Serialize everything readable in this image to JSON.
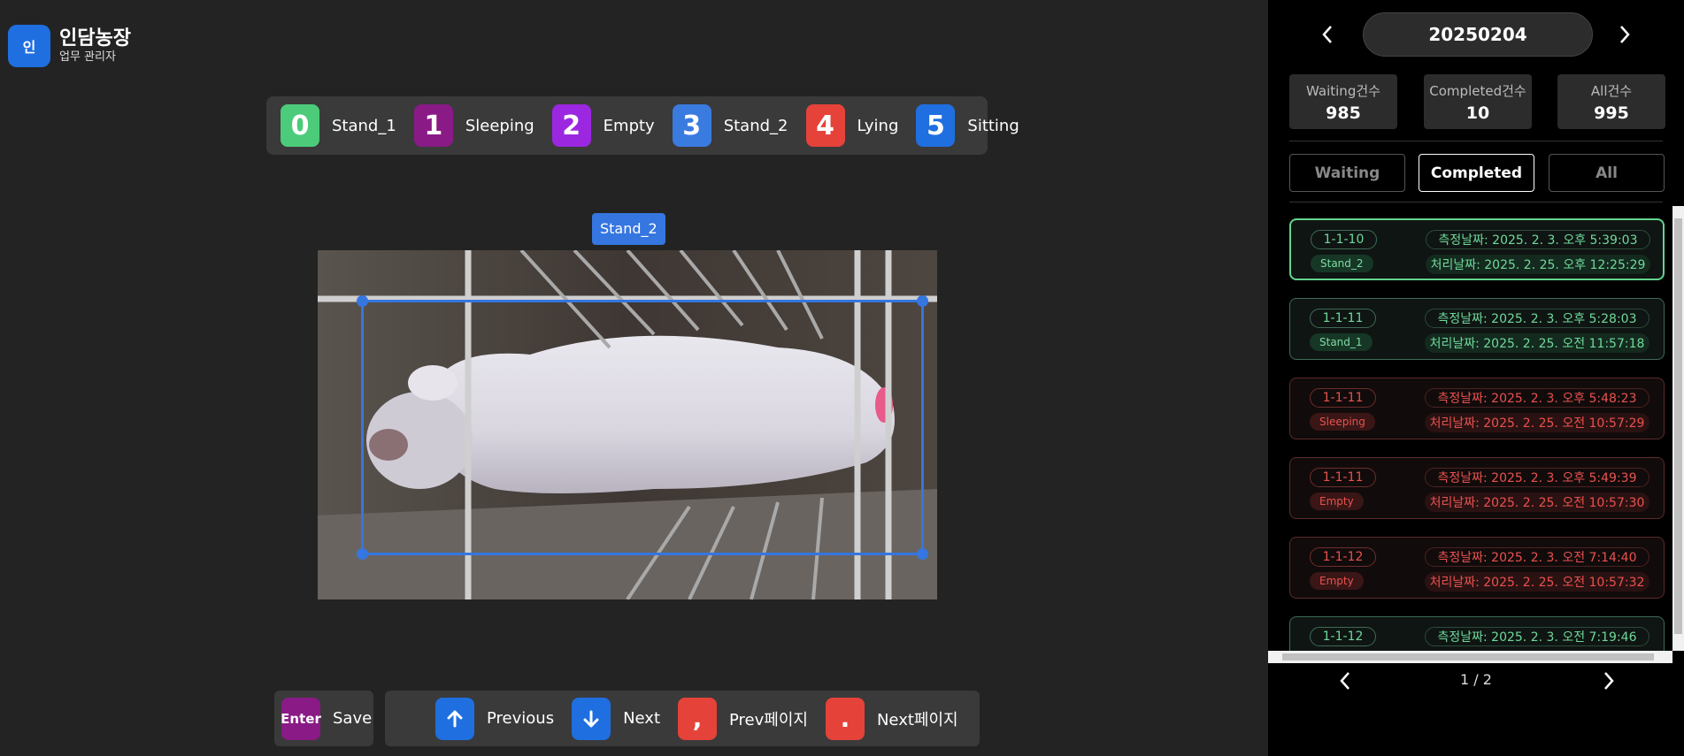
{
  "app": {
    "logo_char": "인",
    "title": "인담농장",
    "subtitle": "업무 관리자"
  },
  "legend": [
    {
      "key": "0",
      "label": "Stand_1",
      "color": "#4ccc7a"
    },
    {
      "key": "1",
      "label": "Sleeping",
      "color": "#8a1a86"
    },
    {
      "key": "2",
      "label": "Empty",
      "color": "#9b27e0"
    },
    {
      "key": "3",
      "label": "Stand_2",
      "color": "#3a7be0"
    },
    {
      "key": "4",
      "label": "Lying",
      "color": "#e5423a"
    },
    {
      "key": "5",
      "label": "Sitting",
      "color": "#1f6fe0"
    }
  ],
  "annotation": {
    "label": "Stand_2",
    "color": "#3576e0"
  },
  "shortcuts": {
    "save": {
      "key": "Enter",
      "label": "Save",
      "color": "#8a1a86"
    },
    "previous": {
      "key": "↑",
      "label": "Previous",
      "color": "#1f6fe0"
    },
    "next": {
      "key": "↓",
      "label": "Next",
      "color": "#1f6fe0"
    },
    "prev_page": {
      "key": ",",
      "label": "Prev페이지",
      "color": "#e5423a"
    },
    "next_page": {
      "key": ".",
      "label": "Next페이지",
      "color": "#e5423a"
    }
  },
  "panel": {
    "date": "20250204",
    "counts": [
      {
        "label": "Waiting건수",
        "value": "985"
      },
      {
        "label": "Completed건수",
        "value": "10"
      },
      {
        "label": "All건수",
        "value": "995"
      }
    ],
    "tabs": [
      "Waiting",
      "Completed",
      "All"
    ],
    "active_tab": "Completed",
    "items": [
      {
        "id": "1-1-10",
        "status": "Stand_2",
        "measured": "측정날짜: 2025. 2. 3. 오후 5:39:03",
        "processed": "처리날짜: 2025. 2. 25. 오후 12:25:29",
        "tone": "green",
        "selected": true
      },
      {
        "id": "1-1-11",
        "status": "Stand_1",
        "measured": "측정날짜: 2025. 2. 3. 오후 5:28:03",
        "processed": "처리날짜: 2025. 2. 25. 오전 11:57:18",
        "tone": "green",
        "selected": false
      },
      {
        "id": "1-1-11",
        "status": "Sleeping",
        "measured": "측정날짜: 2025. 2. 3. 오후 5:48:23",
        "processed": "처리날짜: 2025. 2. 25. 오전 10:57:29",
        "tone": "red",
        "selected": false
      },
      {
        "id": "1-1-11",
        "status": "Empty",
        "measured": "측정날짜: 2025. 2. 3. 오후 5:49:39",
        "processed": "처리날짜: 2025. 2. 25. 오전 10:57:30",
        "tone": "red",
        "selected": false
      },
      {
        "id": "1-1-12",
        "status": "Empty",
        "measured": "측정날짜: 2025. 2. 3. 오전 7:14:40",
        "processed": "처리날짜: 2025. 2. 25. 오전 10:57:32",
        "tone": "red",
        "selected": false
      },
      {
        "id": "1-1-12",
        "status": "",
        "measured": "측정날짜: 2025. 2. 3. 오전 7:19:46",
        "processed": "",
        "tone": "green",
        "selected": false
      }
    ],
    "pagination": "1 / 2"
  }
}
